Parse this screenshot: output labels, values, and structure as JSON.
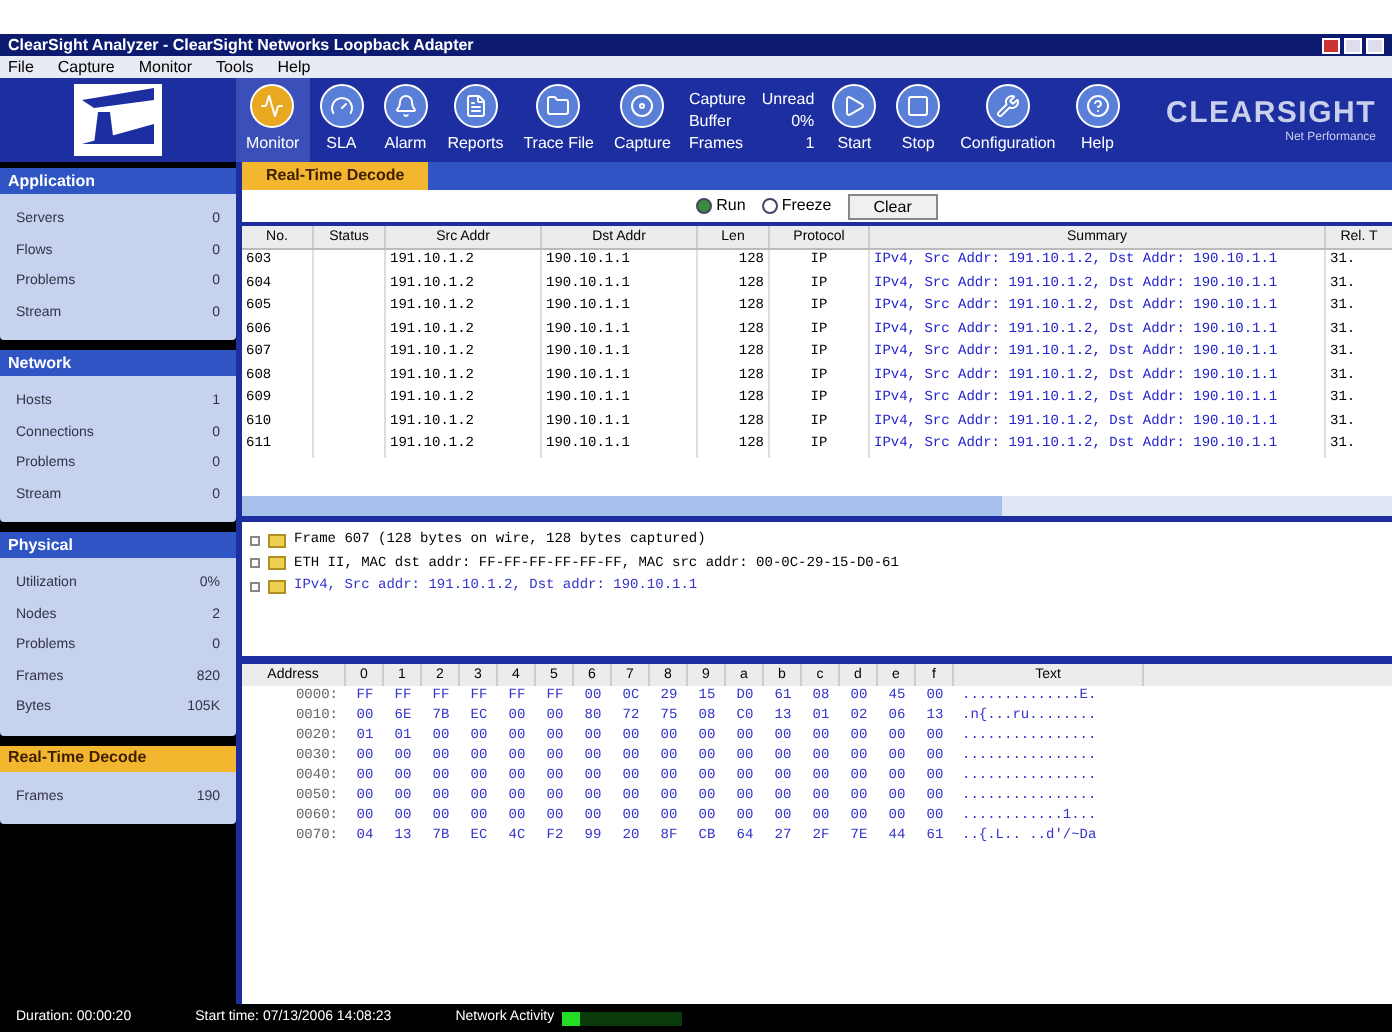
{
  "window": {
    "title": "ClearSight Analyzer - ClearSight Networks Loopback Adapter"
  },
  "menu": [
    "File",
    "Capture",
    "Monitor",
    "Tools",
    "Help"
  ],
  "toolbar": [
    {
      "kind": "button",
      "label": "Monitor",
      "selected": true
    },
    {
      "kind": "button",
      "label": "SLA",
      "selected": false
    },
    {
      "kind": "button",
      "label": "Alarm",
      "selected": false
    },
    {
      "kind": "button",
      "label": "Reports",
      "selected": false
    },
    {
      "kind": "button",
      "label": "Trace File",
      "selected": false
    },
    {
      "kind": "button",
      "label": "Capture",
      "selected": false
    },
    {
      "kind": "stats",
      "lines": [
        "Capture",
        "Buffer",
        "Frames"
      ]
    },
    {
      "kind": "stats",
      "lines": [
        "Unread",
        "0%",
        "1"
      ]
    },
    {
      "kind": "button",
      "label": "Start",
      "selected": false
    },
    {
      "kind": "button",
      "label": "Stop",
      "selected": false
    },
    {
      "kind": "button",
      "label": "Configuration",
      "selected": false
    },
    {
      "kind": "button",
      "label": "Help",
      "selected": false
    }
  ],
  "logo": {
    "name": "CLEARSIGHT",
    "tagline": "Net Performance"
  },
  "sidebar": [
    {
      "title": "Application",
      "selected": false,
      "items": [
        {
          "label": "Servers",
          "value": "0"
        },
        {
          "label": "Flows",
          "value": "0"
        },
        {
          "label": "Problems",
          "value": "0"
        },
        {
          "label": "Stream",
          "value": "0"
        }
      ]
    },
    {
      "title": "Network",
      "selected": false,
      "items": [
        {
          "label": "Hosts",
          "value": "1"
        },
        {
          "label": "Connections",
          "value": "0"
        },
        {
          "label": "Problems",
          "value": "0"
        },
        {
          "label": "Stream",
          "value": "0"
        }
      ]
    },
    {
      "title": "Physical",
      "selected": false,
      "items": [
        {
          "label": "Utilization",
          "value": "0%"
        },
        {
          "label": "Nodes",
          "value": "2"
        },
        {
          "label": "Problems",
          "value": "0"
        },
        {
          "label": "Frames",
          "value": "820"
        },
        {
          "label": "Bytes",
          "value": "105K"
        }
      ]
    },
    {
      "title": "Real-Time Decode",
      "selected": true,
      "items": [
        {
          "label": "Frames",
          "value": "190"
        }
      ]
    }
  ],
  "tab": {
    "label": "Real-Time Decode",
    "selected": true
  },
  "controls": {
    "radios": [
      {
        "label": "Run",
        "selected": true
      },
      {
        "label": "Freeze",
        "selected": false
      }
    ],
    "button": "Clear"
  },
  "table": {
    "columns": [
      "No.",
      "Status",
      "Src Addr",
      "Dst Addr",
      "Len",
      "Protocol",
      "Summary",
      "Rel. T"
    ],
    "rows": [
      [
        "603",
        "",
        "191.10.1.2",
        "190.10.1.1",
        "128",
        "IP",
        "IPv4, Src Addr: 191.10.1.2, Dst Addr: 190.10.1.1",
        "31."
      ],
      [
        "604",
        "",
        "191.10.1.2",
        "190.10.1.1",
        "128",
        "IP",
        "IPv4, Src Addr: 191.10.1.2, Dst Addr: 190.10.1.1",
        "31."
      ],
      [
        "605",
        "",
        "191.10.1.2",
        "190.10.1.1",
        "128",
        "IP",
        "IPv4, Src Addr: 191.10.1.2, Dst Addr: 190.10.1.1",
        "31."
      ],
      [
        "606",
        "",
        "191.10.1.2",
        "190.10.1.1",
        "128",
        "IP",
        "IPv4, Src Addr: 191.10.1.2, Dst Addr: 190.10.1.1",
        "31."
      ],
      [
        "607",
        "",
        "191.10.1.2",
        "190.10.1.1",
        "128",
        "IP",
        "IPv4, Src Addr: 191.10.1.2, Dst Addr: 190.10.1.1",
        "31."
      ],
      [
        "608",
        "",
        "191.10.1.2",
        "190.10.1.1",
        "128",
        "IP",
        "IPv4, Src Addr: 191.10.1.2, Dst Addr: 190.10.1.1",
        "31."
      ],
      [
        "609",
        "",
        "191.10.1.2",
        "190.10.1.1",
        "128",
        "IP",
        "IPv4, Src Addr: 191.10.1.2, Dst Addr: 190.10.1.1",
        "31."
      ],
      [
        "610",
        "",
        "191.10.1.2",
        "190.10.1.1",
        "128",
        "IP",
        "IPv4, Src Addr: 191.10.1.2, Dst Addr: 190.10.1.1",
        "31."
      ],
      [
        "611",
        "",
        "191.10.1.2",
        "190.10.1.1",
        "128",
        "IP",
        "IPv4, Src Addr: 191.10.1.2, Dst Addr: 190.10.1.1",
        "31."
      ]
    ]
  },
  "tree": [
    {
      "label": "Frame 607 (128 bytes on wire, 128 bytes captured)",
      "kind": "plain"
    },
    {
      "label": "ETH II, MAC dst addr: FF-FF-FF-FF-FF-FF, MAC src addr: 00-0C-29-15-D0-61",
      "kind": "plain"
    },
    {
      "label": "IPv4, Src addr: 191.10.1.2, Dst addr: 190.10.1.1",
      "kind": "link"
    }
  ],
  "hex": {
    "columns": [
      "Address",
      "0",
      "1",
      "2",
      "3",
      "4",
      "5",
      "6",
      "7",
      "8",
      "9",
      "a",
      "b",
      "c",
      "d",
      "e",
      "f",
      "Text"
    ],
    "rows": [
      [
        "0000:",
        "FF",
        "FF",
        "FF",
        "FF",
        "FF",
        "FF",
        "00",
        "0C",
        "29",
        "15",
        "D0",
        "61",
        "08",
        "00",
        "45",
        "00",
        "..............E."
      ],
      [
        "0010:",
        "00",
        "6E",
        "7B",
        "EC",
        "00",
        "00",
        "80",
        "72",
        "75",
        "08",
        "C0",
        "13",
        "01",
        "02",
        "06",
        "13",
        ".n{...ru........"
      ],
      [
        "0020:",
        "01",
        "01",
        "00",
        "00",
        "00",
        "00",
        "00",
        "00",
        "00",
        "00",
        "00",
        "00",
        "00",
        "00",
        "00",
        "00",
        "................"
      ],
      [
        "0030:",
        "00",
        "00",
        "00",
        "00",
        "00",
        "00",
        "00",
        "00",
        "00",
        "00",
        "00",
        "00",
        "00",
        "00",
        "00",
        "00",
        "................"
      ],
      [
        "0040:",
        "00",
        "00",
        "00",
        "00",
        "00",
        "00",
        "00",
        "00",
        "00",
        "00",
        "00",
        "00",
        "00",
        "00",
        "00",
        "00",
        "................"
      ],
      [
        "0050:",
        "00",
        "00",
        "00",
        "00",
        "00",
        "00",
        "00",
        "00",
        "00",
        "00",
        "00",
        "00",
        "00",
        "00",
        "00",
        "00",
        "................"
      ],
      [
        "0060:",
        "00",
        "00",
        "00",
        "00",
        "00",
        "00",
        "00",
        "00",
        "00",
        "00",
        "00",
        "00",
        "00",
        "00",
        "00",
        "00",
        "............1..."
      ],
      [
        "0070:",
        "04",
        "13",
        "7B",
        "EC",
        "4C",
        "F2",
        "99",
        "20",
        "8F",
        "CB",
        "64",
        "27",
        "2F",
        "7E",
        "44",
        "61",
        "..{.L.. ..d'/~Da"
      ]
    ]
  },
  "status_bar": {
    "duration": "Duration: 00:00:20",
    "start_time": "Start time: 07/13/2006 14:08:23",
    "activity_label": "Network Activity",
    "level": 0.15
  }
}
